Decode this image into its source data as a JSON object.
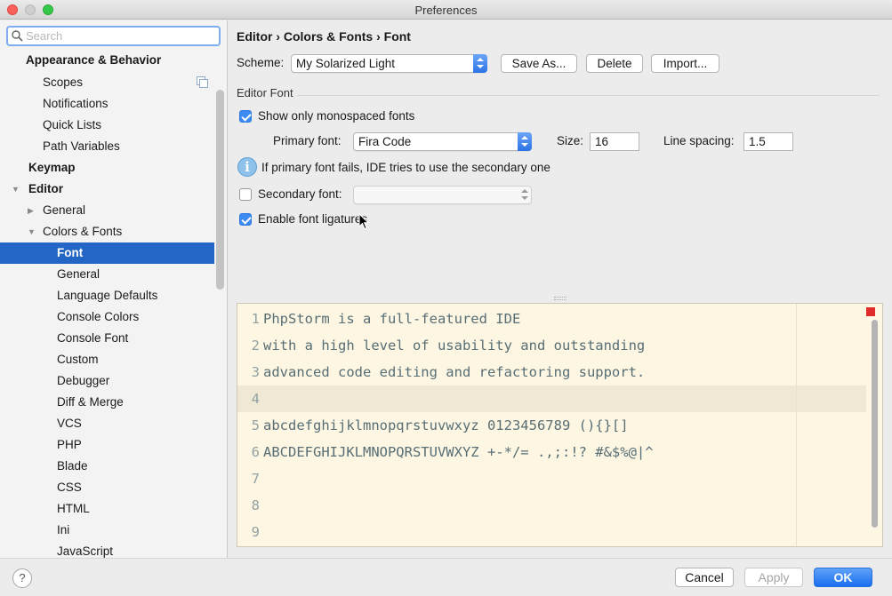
{
  "window": {
    "title": "Preferences"
  },
  "search": {
    "placeholder": "Search"
  },
  "sidebar": {
    "items": [
      {
        "label": "Appearance & Behavior"
      },
      {
        "label": "Scopes"
      },
      {
        "label": "Notifications"
      },
      {
        "label": "Quick Lists"
      },
      {
        "label": "Path Variables"
      },
      {
        "label": "Keymap"
      },
      {
        "label": "Editor"
      },
      {
        "label": "General"
      },
      {
        "label": "Colors & Fonts"
      },
      {
        "label": "Font"
      },
      {
        "label": "General"
      },
      {
        "label": "Language Defaults"
      },
      {
        "label": "Console Colors"
      },
      {
        "label": "Console Font"
      },
      {
        "label": "Custom"
      },
      {
        "label": "Debugger"
      },
      {
        "label": "Diff & Merge"
      },
      {
        "label": "VCS"
      },
      {
        "label": "PHP"
      },
      {
        "label": "Blade"
      },
      {
        "label": "CSS"
      },
      {
        "label": "HTML"
      },
      {
        "label": "Ini"
      },
      {
        "label": "JavaScript"
      }
    ]
  },
  "main": {
    "breadcrumb": "Editor › Colors & Fonts › Font",
    "scheme": {
      "label": "Scheme:",
      "value": "My Solarized Light",
      "buttons": {
        "save_as": "Save As...",
        "delete": "Delete",
        "import": "Import..."
      }
    },
    "editor_font": {
      "group_title": "Editor Font",
      "show_monospaced": {
        "label": "Show only monospaced fonts",
        "checked": true
      },
      "primary_font": {
        "label": "Primary font:",
        "value": "Fira Code"
      },
      "size": {
        "label": "Size:",
        "value": "16"
      },
      "line_spacing": {
        "label": "Line spacing:",
        "value": "1.5"
      },
      "info": "If primary font fails, IDE tries to use the secondary one",
      "secondary_font": {
        "label": "Secondary font:",
        "value": "",
        "checked": false
      },
      "ligatures": {
        "label": "Enable font ligatures",
        "checked": true
      }
    },
    "preview": {
      "lines": [
        {
          "num": "1",
          "text": "PhpStorm is a full-featured IDE"
        },
        {
          "num": "2",
          "text": "with a high level of usability and outstanding"
        },
        {
          "num": "3",
          "text": "advanced code editing and refactoring support."
        },
        {
          "num": "4",
          "text": ""
        },
        {
          "num": "5",
          "text": "abcdefghijklmnopqrstuvwxyz 0123456789 (){}[]"
        },
        {
          "num": "6",
          "text": "ABCDEFGHIJKLMNOPQRSTUVWXYZ +-*/= .,;:!? #&$%@|^"
        },
        {
          "num": "7",
          "text": ""
        },
        {
          "num": "8",
          "text": ""
        },
        {
          "num": "9",
          "text": ""
        }
      ]
    }
  },
  "footer": {
    "help": "?",
    "cancel": "Cancel",
    "apply": "Apply",
    "ok": "OK"
  },
  "colors": {
    "selection": "#2466c5",
    "preview_bg": "#fdf6e3",
    "ok_button": "#1a6ef0"
  }
}
